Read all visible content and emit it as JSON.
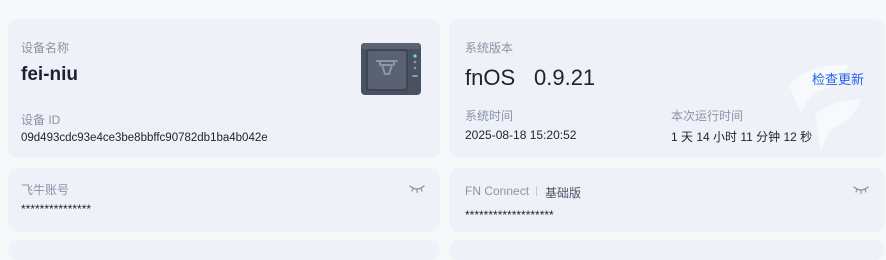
{
  "device": {
    "name_label": "设备名称",
    "name_value": "fei-niu",
    "id_label": "设备 ID",
    "id_value": "09d493cdc93e4ce3be8bbffc90782db1ba4b042e",
    "icon": "nas-device-icon"
  },
  "system": {
    "version_label": "系统版本",
    "os_name": "fnOS",
    "os_version": "0.9.21",
    "check_update_label": "检查更新",
    "time_label": "系统时间",
    "time_value": "2025-08-18 15:20:52",
    "uptime_label": "本次运行时间",
    "uptime_value": "1 天 14 小时 11 分钟 12 秒",
    "watermark_icon": "fnos-logo-watermark"
  },
  "account": {
    "label": "飞牛账号",
    "value": "***************",
    "toggle_icon": "eye-closed-icon"
  },
  "fn_connect": {
    "label": "FN Connect",
    "plan": "基础版",
    "value": "*******************",
    "toggle_icon": "eye-closed-icon"
  },
  "colors": {
    "card_bg": "#eef2f8",
    "link": "#2563eb",
    "muted_text": "#8a94a6",
    "primary_text": "#1c2230"
  }
}
